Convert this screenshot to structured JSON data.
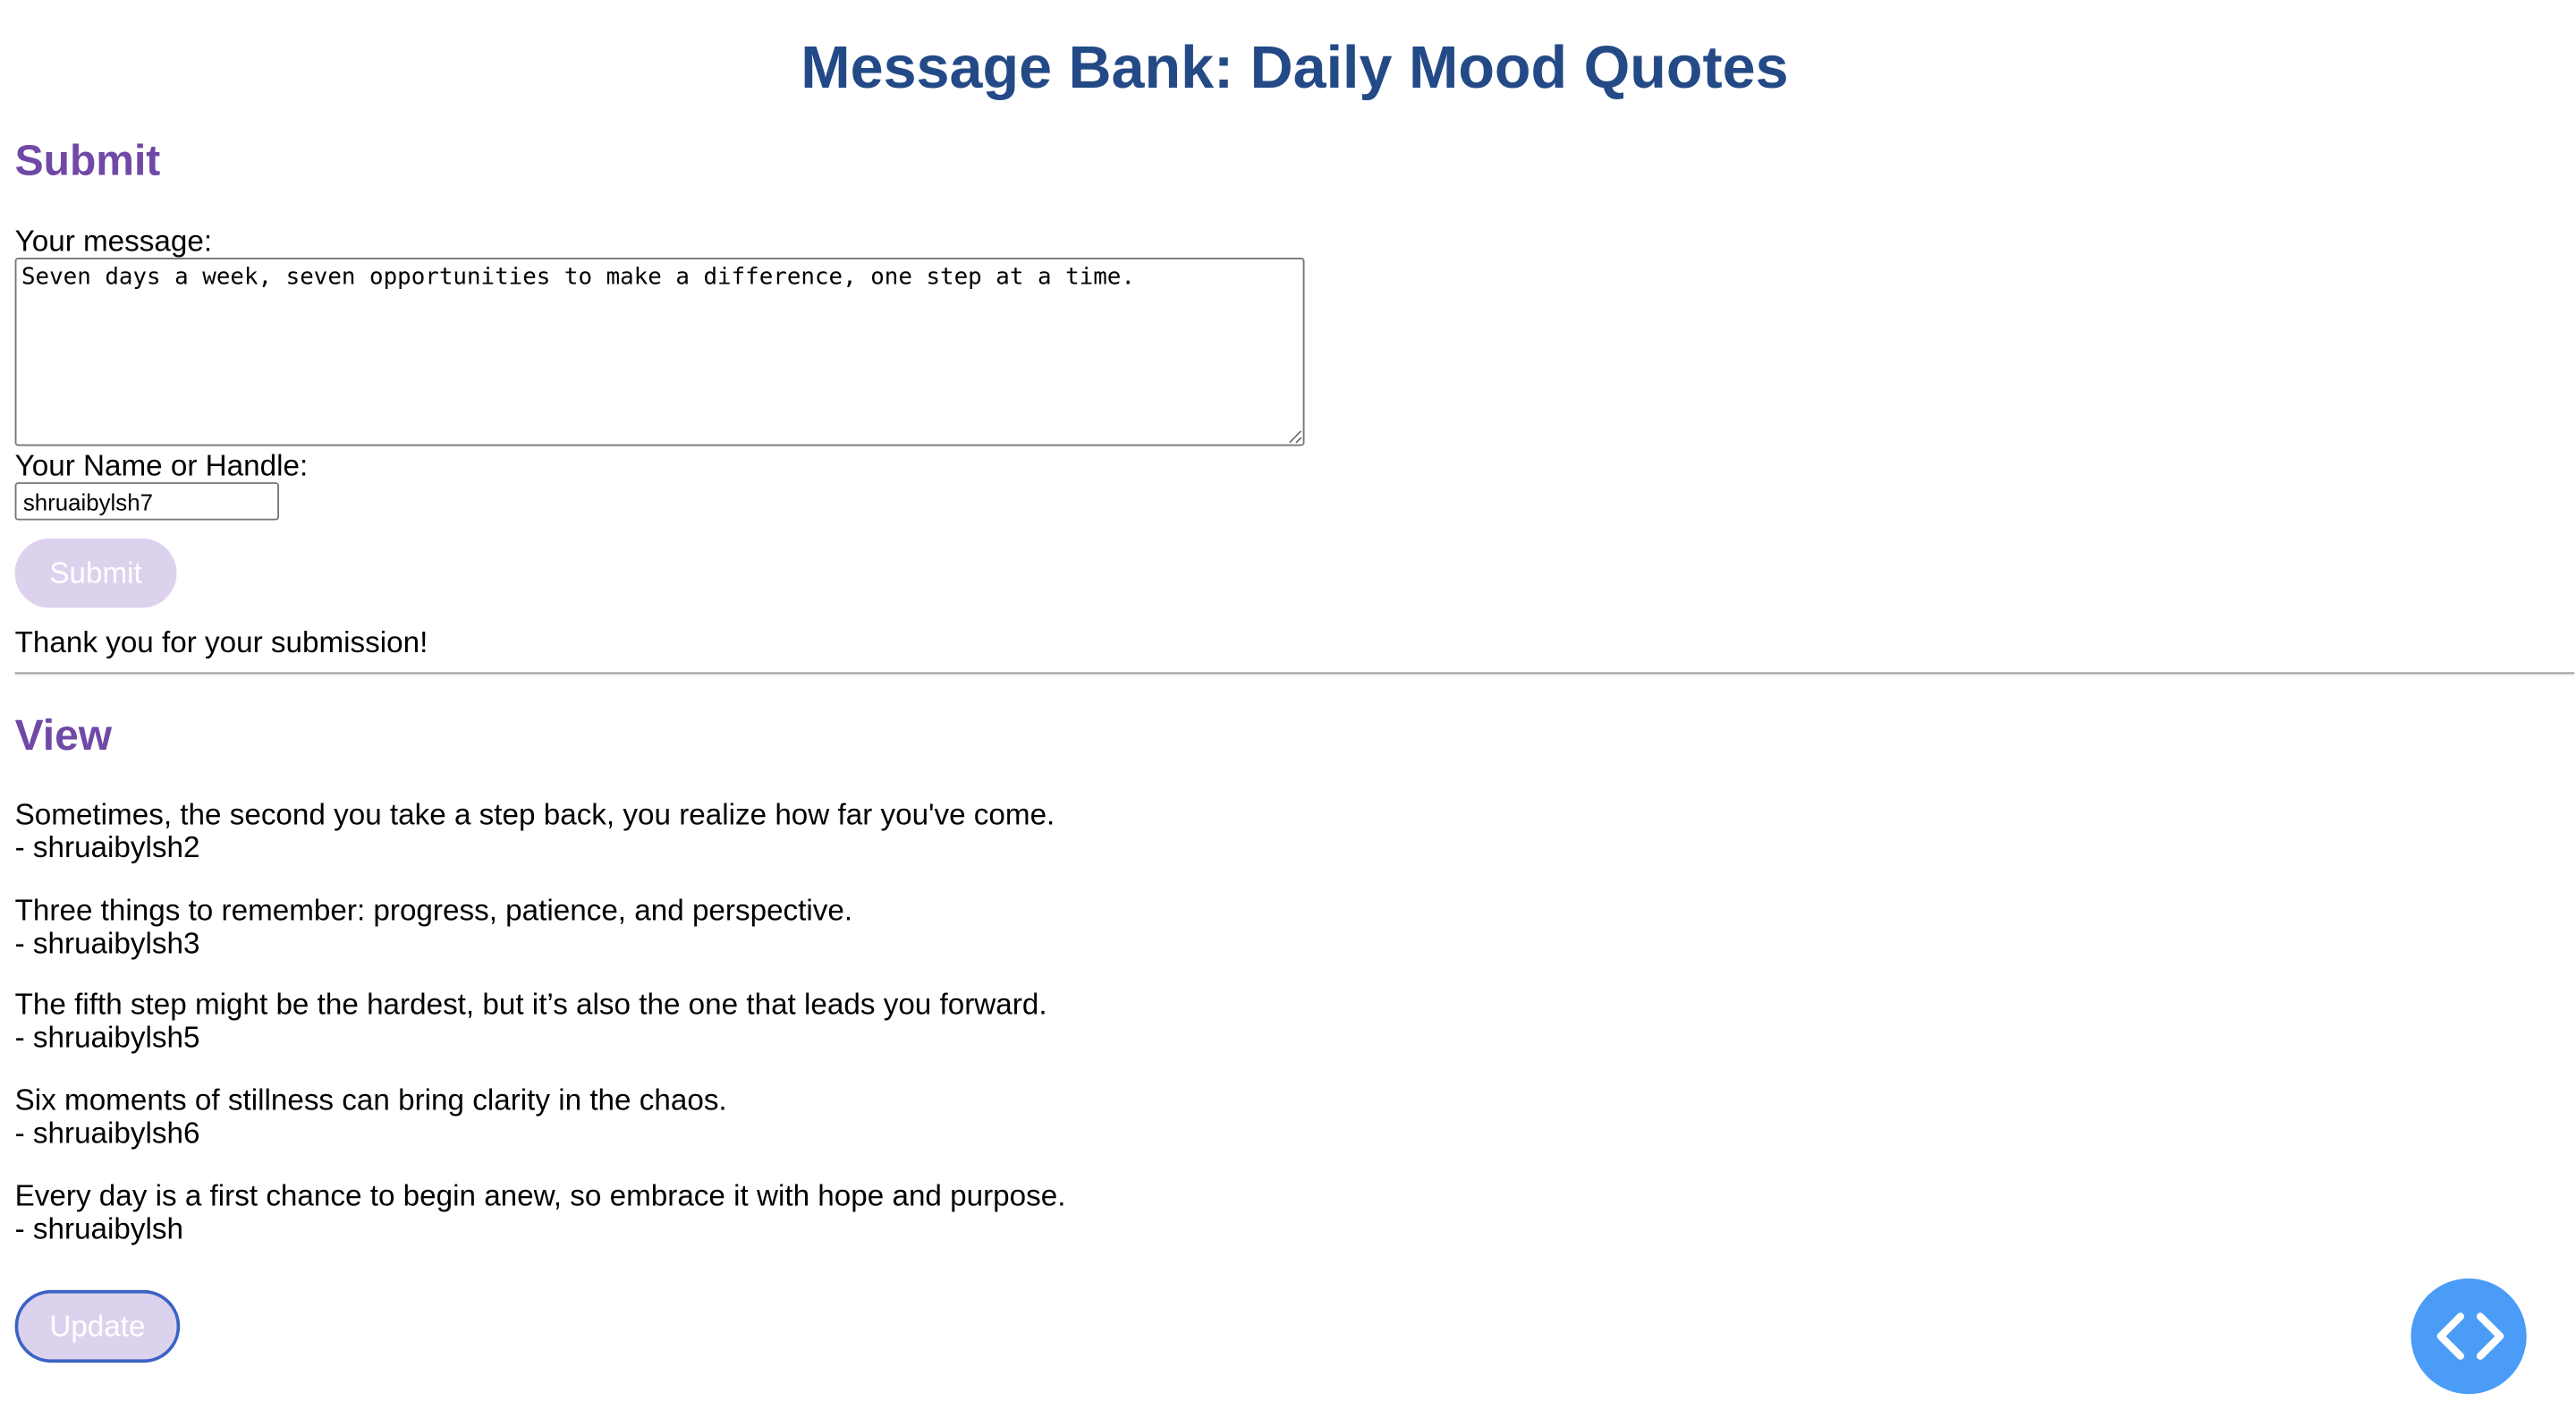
{
  "header": {
    "title": "Message Bank: Daily Mood Quotes"
  },
  "submit_section": {
    "heading": "Submit",
    "message_label": "Your message:",
    "message_value": "Seven days a week, seven opportunities to make a difference, one step at a time.",
    "name_label": "Your Name or Handle:",
    "name_value": "shruaibylsh7",
    "submit_label": "Submit",
    "thank_you": "Thank you for your submission!"
  },
  "view_section": {
    "heading": "View",
    "messages": [
      {
        "text": "Sometimes, the second you take a step back, you realize how far you've come.",
        "author": "- shruaibylsh2"
      },
      {
        "text": "Three things to remember: progress, patience, and perspective.",
        "author": "- shruaibylsh3"
      },
      {
        "text": "The fifth step might be the hardest, but it’s also the one that leads you forward.",
        "author": "- shruaibylsh5"
      },
      {
        "text": "Six moments of stillness can bring clarity in the chaos.",
        "author": "- shruaibylsh6"
      },
      {
        "text": "Every day is a first chance to begin anew, so embrace it with hope and purpose.",
        "author": "- shruaibylsh"
      }
    ],
    "update_label": "Update"
  },
  "fab": {
    "icon": "code-brackets-icon"
  },
  "colors": {
    "title": "#234a86",
    "section_heading": "#7049a6",
    "button_bg": "#ddd2ee",
    "button_text": "#ffffff",
    "update_border": "#3b63c4",
    "fab": "#4a9cf7"
  }
}
